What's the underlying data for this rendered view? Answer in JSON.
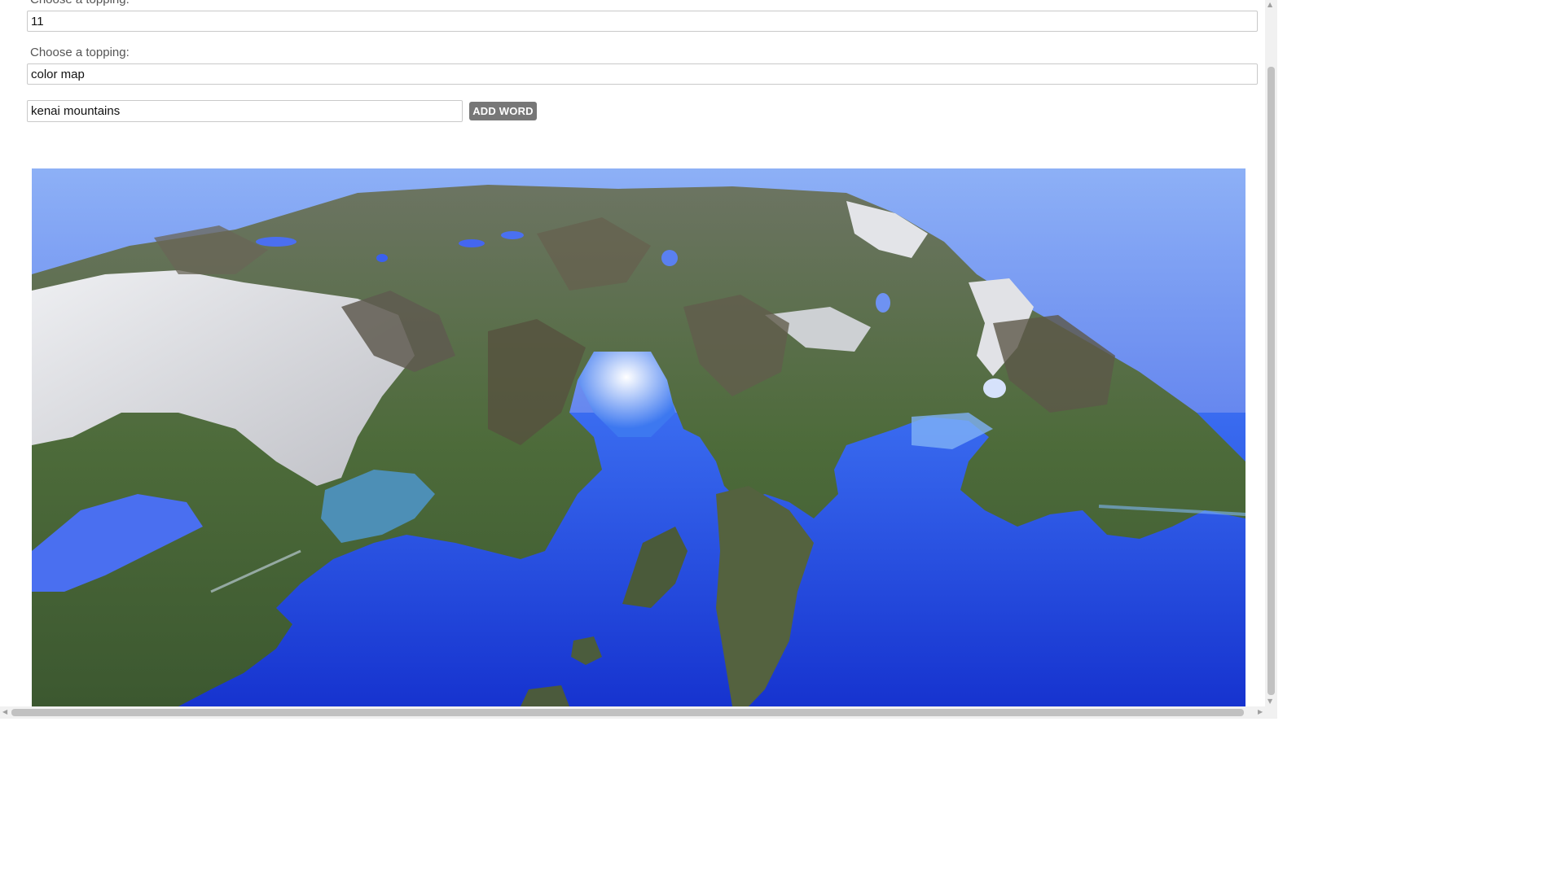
{
  "form": {
    "topping_label_1": "Choose a topping:",
    "topping_value_1": "11",
    "topping_label_2": "Choose a topping:",
    "topping_value_2": "color map",
    "word_value": "kenai mountains",
    "add_word_label": "ADD WORD"
  },
  "icons": {
    "scroll_up": "scroll-up-arrow-icon",
    "scroll_down": "scroll-down-arrow-icon",
    "scroll_left": "scroll-left-arrow-icon",
    "scroll_right": "scroll-right-arrow-icon"
  },
  "colors": {
    "button_bg": "#777777",
    "ocean": "#1a3fd8",
    "sky_top": "#8aaef5",
    "sky_bottom": "#3b5fe8",
    "glacier": "#dcdde2",
    "forest": "#4b6e36",
    "rock": "#6f6a5c"
  }
}
